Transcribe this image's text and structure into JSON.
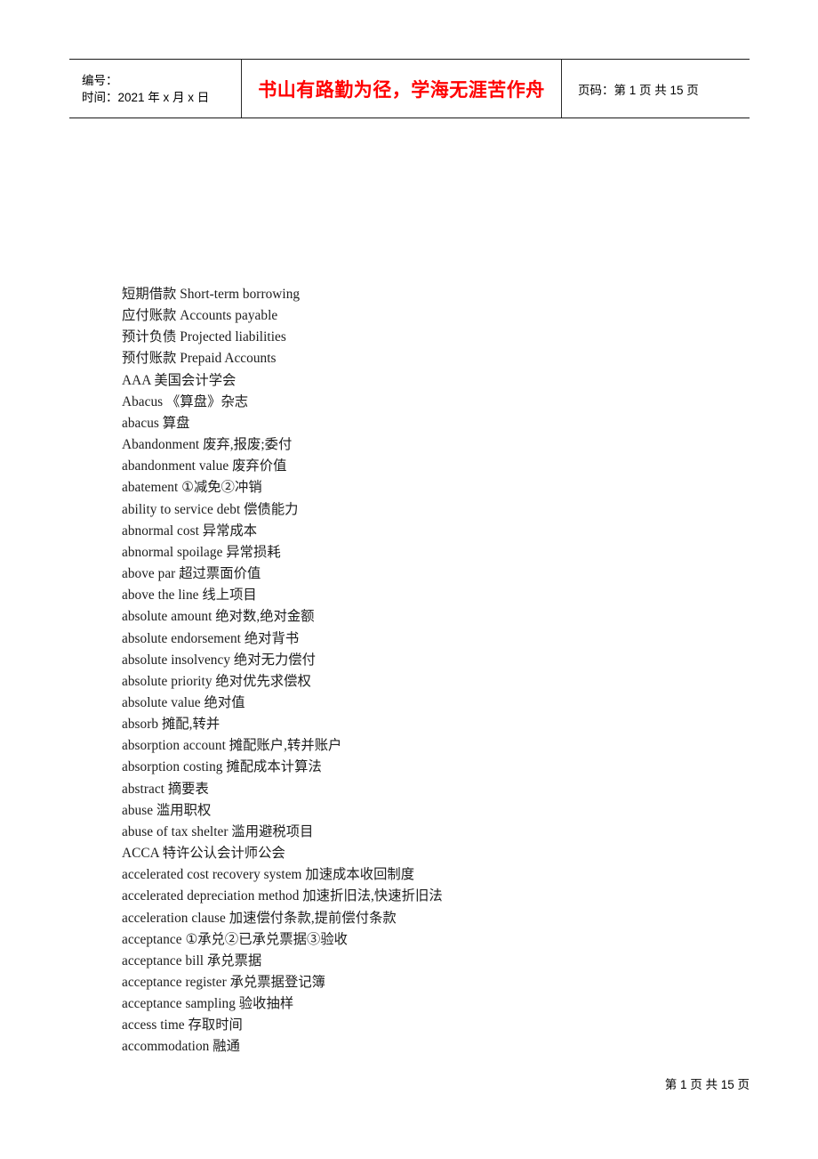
{
  "header": {
    "left_cell": {
      "line1_label": "编号：",
      "line2": "时间：2021 年 x 月 x 日"
    },
    "center_cell": {
      "slogan": "书山有路勤为径，学海无涯苦作舟",
      "slogan_color": "#ff0000"
    },
    "right_cell": {
      "page_code": "页码：第 1 页  共 15 页"
    }
  },
  "body": {
    "entries": [
      "短期借款 Short-term borrowing",
      "应付账款 Accounts payable",
      "预计负债 Projected liabilities",
      "预付账款 Prepaid Accounts",
      "AAA  美国会计学会",
      "Abacus  《算盘》杂志",
      "abacus  算盘",
      "Abandonment  废弃,报废;委付",
      "abandonment value  废弃价值",
      "abatement  ①减免②冲销",
      "ability to service debt  偿债能力",
      "abnormal cost  异常成本",
      "abnormal spoilage  异常损耗",
      "above par  超过票面价值",
      "above the line  线上项目",
      "absolute amount  绝对数,绝对金额",
      "absolute endorsement  绝对背书",
      "absolute insolvency  绝对无力偿付",
      "absolute priority  绝对优先求偿权",
      "absolute value  绝对值",
      "absorb  摊配,转并",
      "absorption account  摊配账户,转并账户",
      "absorption costing  摊配成本计算法",
      "abstract  摘要表",
      "abuse  滥用职权",
      "abuse of tax shelter  滥用避税项目",
      "ACCA  特许公认会计师公会",
      "accelerated cost recovery system  加速成本收回制度",
      "accelerated depreciation method  加速折旧法,快速折旧法",
      "acceleration clause  加速偿付条款,提前偿付条款",
      "acceptance  ①承兑②已承兑票据③验收",
      "acceptance bill  承兑票据",
      "acceptance register  承兑票据登记簿",
      "acceptance sampling  验收抽样",
      "access time  存取时间",
      "accommodation  融通"
    ]
  },
  "footer": {
    "page_indicator": "第 1 页 共 15 页"
  }
}
